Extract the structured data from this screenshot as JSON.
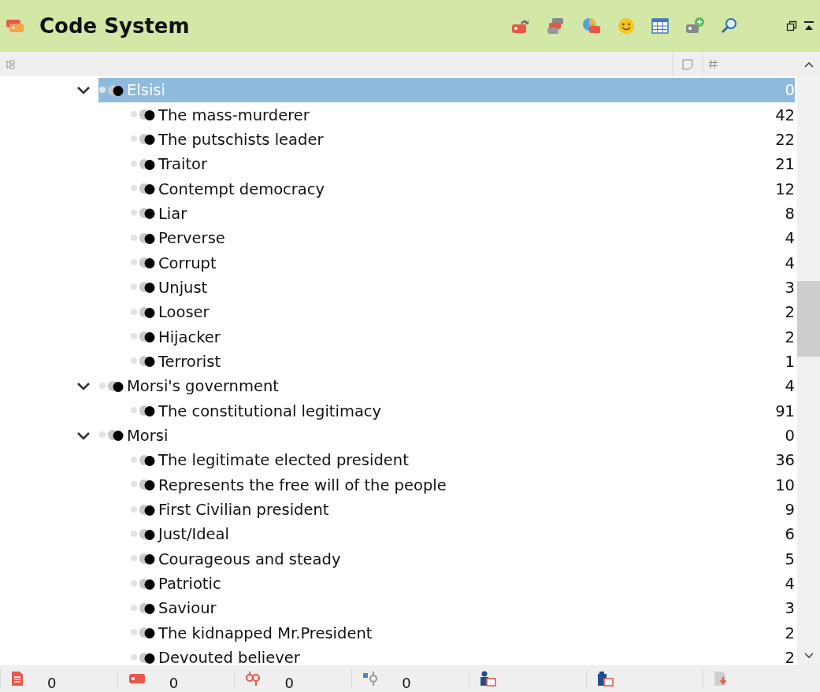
{
  "panel": {
    "title": "Code System"
  },
  "tree": [
    {
      "label": "Elsisi",
      "count": "0",
      "expanded": true,
      "selected": true,
      "children": [
        {
          "label": "The mass-murderer",
          "count": "42",
          "selected": false
        },
        {
          "label": "The putschists leader",
          "count": "22",
          "selected": false
        },
        {
          "label": "Traitor",
          "count": "21",
          "selected": false
        },
        {
          "label": "Contempt democracy",
          "count": "12",
          "selected": false
        },
        {
          "label": "Liar",
          "count": "8",
          "selected": false
        },
        {
          "label": "Perverse",
          "count": "4",
          "selected": false
        },
        {
          "label": "Corrupt",
          "count": "4",
          "selected": false
        },
        {
          "label": "Unjust",
          "count": "3",
          "selected": false
        },
        {
          "label": "Looser",
          "count": "2",
          "selected": false
        },
        {
          "label": "Hijacker",
          "count": "2",
          "selected": false
        },
        {
          "label": "Terrorist",
          "count": "1",
          "selected": false
        }
      ]
    },
    {
      "label": "Morsi's government",
      "count": "4",
      "expanded": true,
      "selected": false,
      "children": [
        {
          "label": "The constitutional legitimacy",
          "count": "91",
          "selected": false
        }
      ]
    },
    {
      "label": "Morsi",
      "count": "0",
      "expanded": true,
      "selected": false,
      "children": [
        {
          "label": "The legitimate elected president",
          "count": "36",
          "selected": false
        },
        {
          "label": "Represents the free will of the people",
          "count": "10",
          "selected": false
        },
        {
          "label": "First Civilian president",
          "count": "9",
          "selected": false
        },
        {
          "label": "Just/Ideal",
          "count": "6",
          "selected": false
        },
        {
          "label": "Courageous and steady",
          "count": "5",
          "selected": false
        },
        {
          "label": "Patriotic",
          "count": "4",
          "selected": false
        },
        {
          "label": "Saviour",
          "count": "3",
          "selected": false
        },
        {
          "label": "The kidnapped Mr.President",
          "count": "2",
          "selected": false
        },
        {
          "label": "Devouted believer",
          "count": "2",
          "selected": false
        }
      ]
    }
  ],
  "status_bar": [
    {
      "kind": "document",
      "count": "0"
    },
    {
      "kind": "code",
      "count": "0"
    },
    {
      "kind": "link",
      "count": "0"
    },
    {
      "kind": "variable",
      "count": "0"
    },
    {
      "kind": "person"
    },
    {
      "kind": "persons"
    },
    {
      "kind": "export"
    }
  ]
}
